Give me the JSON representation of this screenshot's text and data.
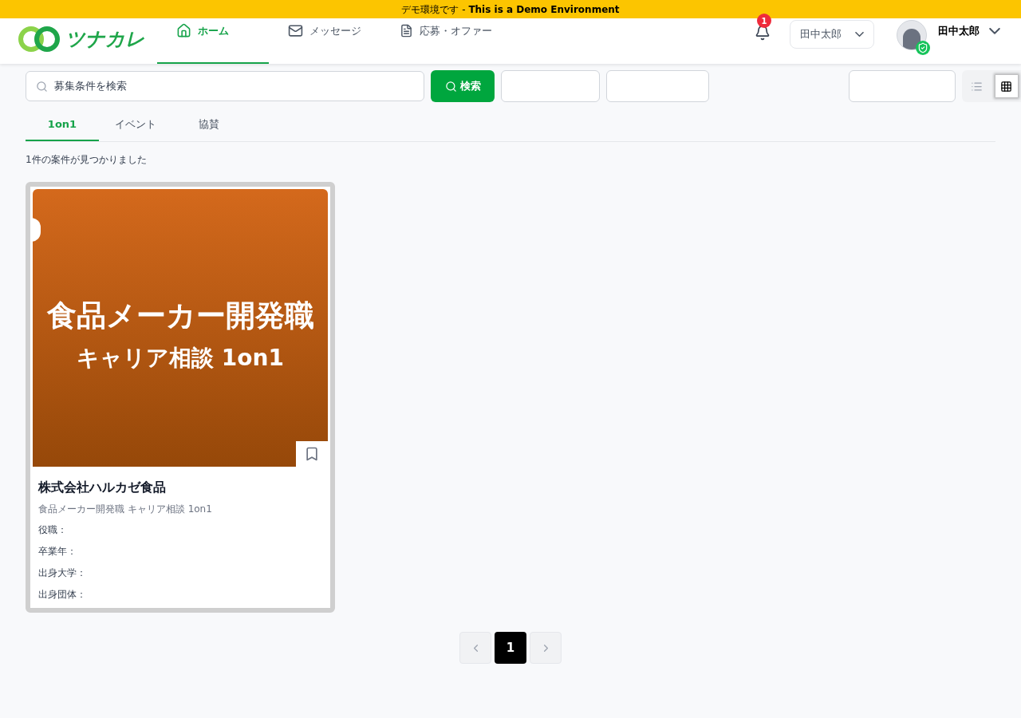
{
  "demo_banner": {
    "prefix": "デモ環境です - ",
    "bold": "This is a Demo Environment"
  },
  "header": {
    "logo": "ツナカレ",
    "nav": [
      {
        "label": "ホーム",
        "selected": true
      },
      {
        "label": "メッセージ",
        "selected": false
      },
      {
        "label": "応募・オファー",
        "selected": false
      }
    ],
    "notification_count": "1",
    "account_select": "田中太郎",
    "user_name": "田中太郎"
  },
  "search": {
    "placeholder": "募集条件を検索",
    "button": "検索",
    "view_toggle": [
      {
        "selected": false
      },
      {
        "selected": true
      }
    ]
  },
  "tabs": [
    {
      "label": "1on1",
      "selected": true
    },
    {
      "label": "イベント",
      "selected": false
    },
    {
      "label": "協賛",
      "selected": false
    }
  ],
  "result_count": "1件の案件が見つかりました",
  "cards": [
    {
      "banner_title": "食品メーカー開発職",
      "banner_subtitle": "キャリア相談 1on1",
      "bookmarked": false,
      "company": "株式会社ハルカゼ食品",
      "subtitle": "食品メーカー開発職 キャリア相談 1on1",
      "fields": [
        "役職：",
        "卒業年：",
        "出身大学：",
        "出身団体："
      ]
    }
  ],
  "pagination": {
    "pages": [
      {
        "label": "1",
        "selected": true
      }
    ]
  }
}
